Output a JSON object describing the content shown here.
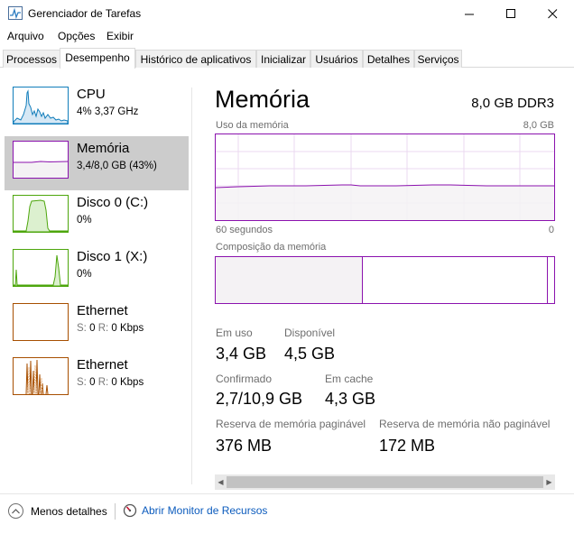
{
  "window": {
    "title": "Gerenciador de Tarefas",
    "icon": "task-manager-icon"
  },
  "menu": [
    "Arquivo",
    "Opções",
    "Exibir"
  ],
  "tabs": [
    {
      "label": "Processos",
      "active": false
    },
    {
      "label": "Desempenho",
      "active": true
    },
    {
      "label": "Histórico de aplicativos",
      "active": false
    },
    {
      "label": "Inicializar",
      "active": false
    },
    {
      "label": "Usuários",
      "active": false
    },
    {
      "label": "Detalhes",
      "active": false
    },
    {
      "label": "Serviços",
      "active": false
    }
  ],
  "sidebar": {
    "items": [
      {
        "title": "CPU",
        "sub": "4% 3,37 GHz",
        "color": "#117dbb",
        "selected": false
      },
      {
        "title": "Memória",
        "sub": "3,4/8,0 GB (43%)",
        "color": "#8b12ae",
        "selected": true
      },
      {
        "title": "Disco 0 (C:)",
        "sub": "0%",
        "color": "#4da60c",
        "selected": false
      },
      {
        "title": "Disco 1 (X:)",
        "sub": "0%",
        "color": "#4da60c",
        "selected": false
      },
      {
        "title": "Ethernet",
        "sub_prefix_s": "S:",
        "sub_val_s": "0",
        "sub_prefix_r": "R:",
        "sub_val_r": "0 Kbps",
        "color": "#a74f01",
        "selected": false
      },
      {
        "title": "Ethernet",
        "sub_prefix_s": "S:",
        "sub_val_s": "0",
        "sub_prefix_r": "R:",
        "sub_val_r": "0 Kbps",
        "color": "#a74f01",
        "selected": false
      }
    ]
  },
  "main": {
    "title": "Memória",
    "spec": "8,0 GB DDR3",
    "usage_label": "Uso da memória",
    "usage_max": "8,0 GB",
    "time_left": "60 segundos",
    "time_right": "0",
    "composition_label": "Composição da memória",
    "accent_color": "#8b12ae",
    "usage_fraction": 0.43,
    "stats": {
      "in_use_label": "Em uso",
      "in_use_value": "3,4 GB",
      "available_label": "Disponível",
      "available_value": "4,5 GB",
      "committed_label": "Confirmado",
      "committed_value": "2,7/10,9 GB",
      "cached_label": "Em cache",
      "cached_value": "4,3 GB",
      "paged_label": "Reserva de memória paginável",
      "paged_value": "376 MB",
      "nonpaged_label": "Reserva de memória não paginável",
      "nonpaged_value": "172 MB"
    }
  },
  "footer": {
    "less_details": "Menos detalhes",
    "resource_monitor": "Abrir Monitor de Recursos"
  }
}
